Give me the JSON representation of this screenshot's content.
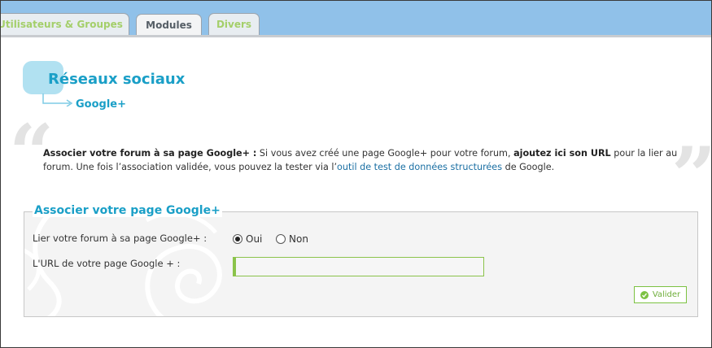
{
  "tabs": [
    {
      "label": "Utilisateurs & Groupes",
      "active": false
    },
    {
      "label": "Modules",
      "active": true
    },
    {
      "label": "Divers",
      "active": false
    }
  ],
  "header": {
    "title": "Réseaux sociaux",
    "subtitle": "Google+"
  },
  "description": {
    "bold_intro": "Associer votre forum à sa page Google+ :",
    "text_1": " Si vous avez créé une page Google+ pour votre forum, ",
    "bold_action": "ajoutez ici son URL",
    "text_2": " pour la lier au forum. Une fois l’association validée, vous pouvez la tester via l’",
    "link_text": "outil de test de données structurées",
    "text_3": " de Google."
  },
  "form": {
    "legend": "Associer votre page Google+",
    "link_label": "Lier votre forum à sa page Google+ :",
    "option_yes": "Oui",
    "option_no": "Non",
    "selected": "Oui",
    "url_label": "L'URL de votre page Google + :",
    "url_value": "",
    "submit_label": "Valider"
  },
  "colors": {
    "accent": "#1a9fc7",
    "tab_bar": "#90c1e9",
    "success": "#7cc242"
  },
  "icons": [
    "quote-open-icon",
    "quote-close-icon",
    "arrow-right-icon",
    "check-icon",
    "swirl-decoration"
  ]
}
